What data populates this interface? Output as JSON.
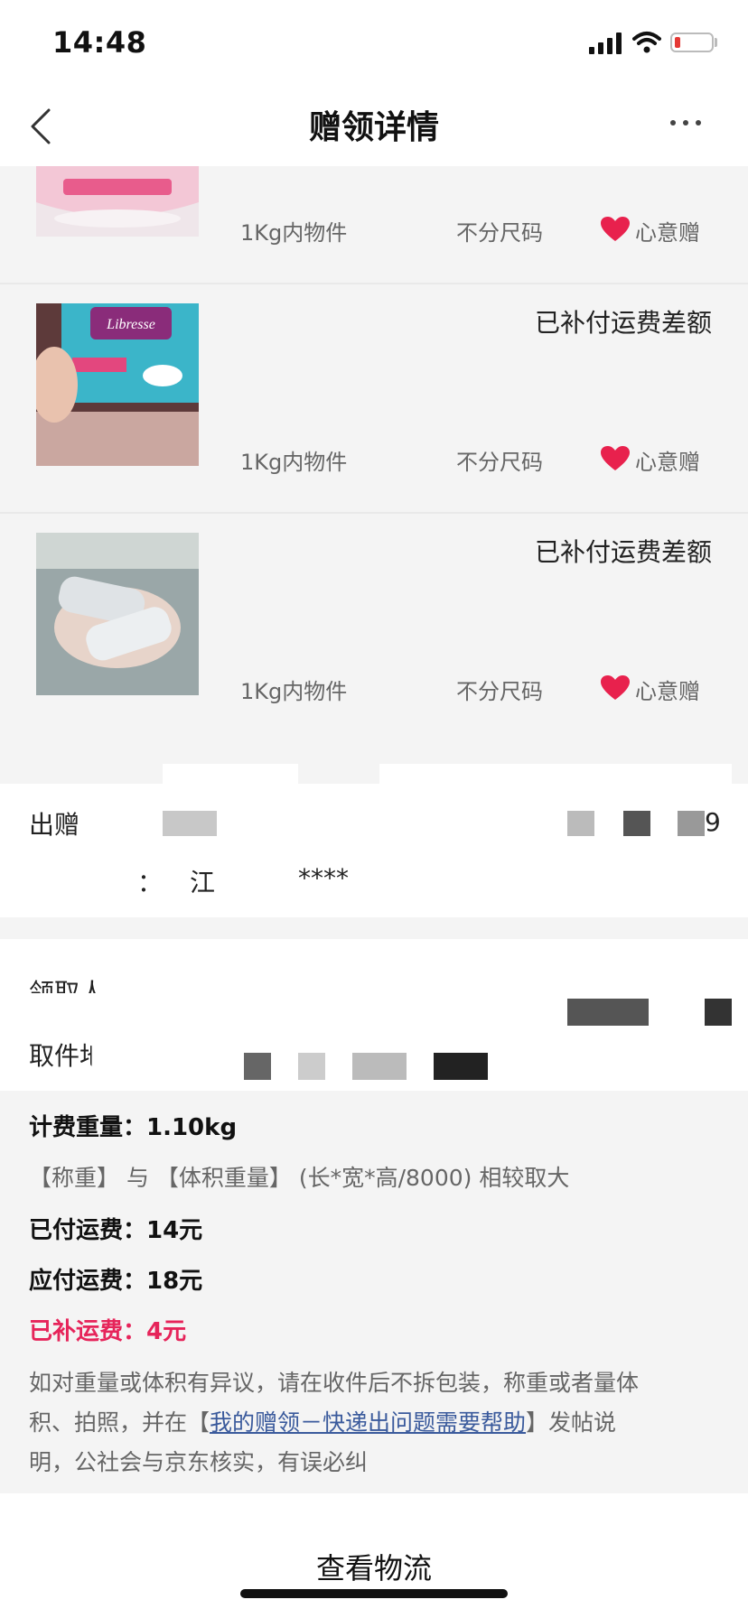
{
  "status_bar": {
    "time": "14:48"
  },
  "nav": {
    "title": "赠领详情"
  },
  "items": [
    {
      "weight": "1Kg内物件",
      "size": "不分尺码",
      "tag": "心意赠",
      "status": ""
    },
    {
      "weight": "1Kg内物件",
      "size": "不分尺码",
      "tag": "心意赠",
      "status": "已补付运费差额"
    },
    {
      "weight": "1Kg内物件",
      "size": "不分尺码",
      "tag": "心意赠",
      "status": "已补付运费差额"
    }
  ],
  "giver": {
    "label": "出赠",
    "tail": "9",
    "addr_colon": "：",
    "addr_part": "江",
    "addr_mask": "****"
  },
  "receiver": {
    "label": "领取人",
    "address_label": "取件地址"
  },
  "fees": {
    "weight": "计费重量：1.10kg",
    "rule": "【称重】 与 【体积重量】 (长*宽*高/8000) 相较取大",
    "paid": "已付运费：14元",
    "payable": "应付运费：18元",
    "supplement": "已补运费：4元"
  },
  "notice": {
    "line1": "如对重量或体积有异议，请在收件后不拆包装，称重或者量体",
    "line2_pre": "积、拍照，并在【",
    "line2_link": "我的赠领－快递出问题需要帮助",
    "line2_post": "】发帖说",
    "line3": "明，公社会与京东核实，有误必纠"
  },
  "button": {
    "logistics": "查看物流"
  },
  "colors": {
    "accent_red": "#e6245a",
    "heart": "#e8214d",
    "link": "#3a5a9c"
  }
}
